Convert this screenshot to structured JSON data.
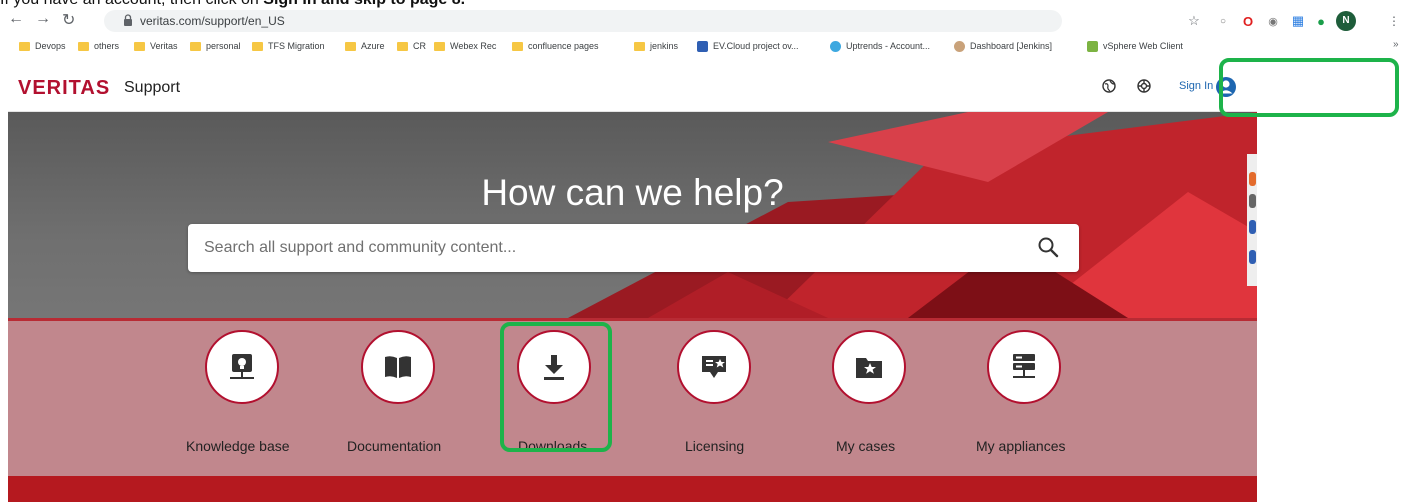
{
  "instruction": {
    "lead": "If you have an account, then click on",
    "bold": "Sign In and skip to page 8."
  },
  "browser": {
    "url": "veritas.com/support/en_US",
    "profile_initial": "N",
    "bookmarks": [
      "Devops",
      "others",
      "Veritas",
      "personal",
      "TFS Migration",
      "Azure",
      "CR",
      "Webex Rec",
      "confluence pages",
      "jenkins",
      "EV.Cloud project ov...",
      "Uptrends - Account...",
      "Dashboard [Jenkins]",
      "vSphere Web Client"
    ]
  },
  "site": {
    "logo": "VERITAS",
    "section": "Support",
    "sign_in": "Sign In",
    "hero_title": "How can we help?",
    "search_placeholder": "Search all support and community content...",
    "quick_links": [
      "Knowledge base",
      "Documentation",
      "Downloads",
      "Licensing",
      "My cases",
      "My appliances"
    ]
  },
  "colors": {
    "brand_red": "#b2102f",
    "quicklink_band": "#c1878d",
    "highlight_green": "#1db34a"
  },
  "icons": {
    "quick_links": [
      "lightbulb-network-icon",
      "book-icon",
      "download-icon",
      "certificate-icon",
      "folder-star-icon",
      "server-icon"
    ]
  }
}
